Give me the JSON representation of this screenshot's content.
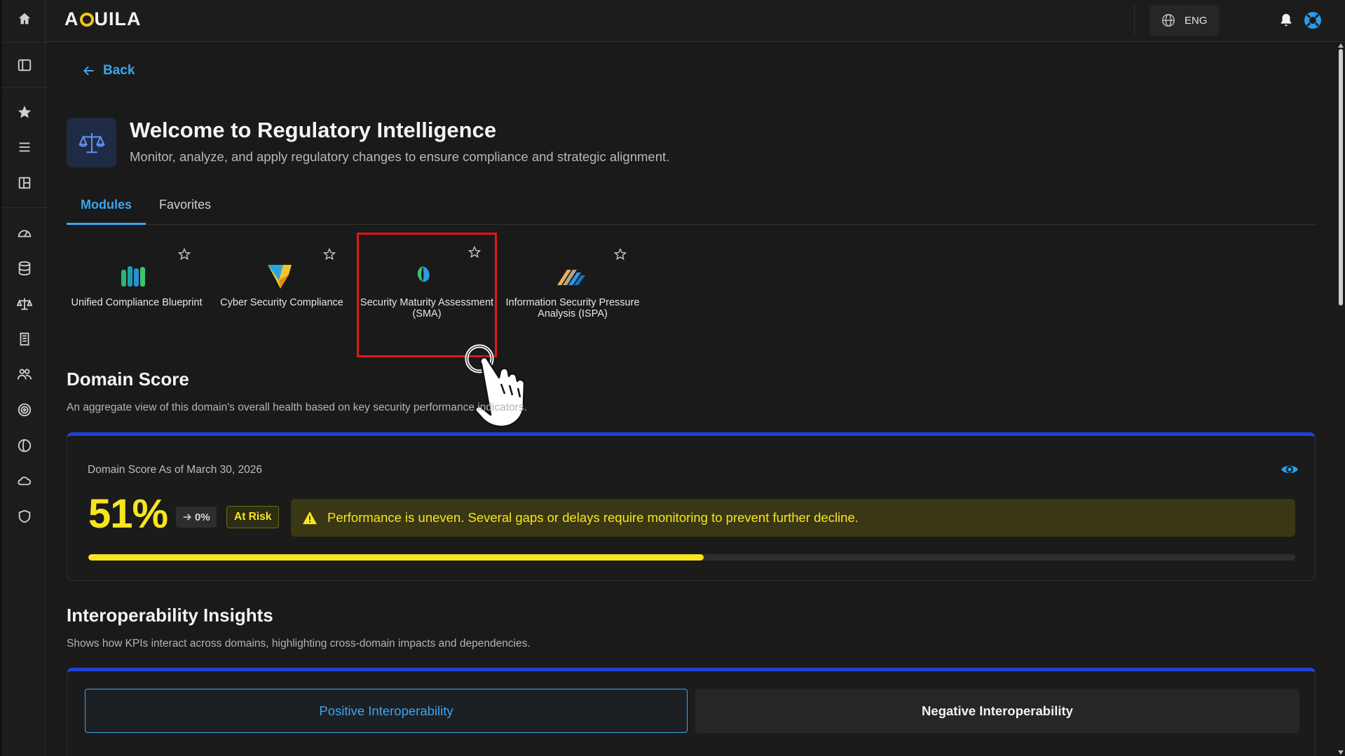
{
  "app": {
    "logo_text_pre": "A",
    "logo_text_post": "UILA"
  },
  "topbar": {
    "language": "ENG"
  },
  "sidebar": {
    "items": [
      "home-icon",
      "panel-icon",
      "star-icon",
      "list-icon",
      "layout-icon",
      "gauge-icon",
      "database-icon",
      "scale-icon",
      "building-icon",
      "users-icon",
      "target-icon",
      "globe-icon",
      "cloud-icon",
      "shield-icon"
    ]
  },
  "nav": {
    "back_label": "Back"
  },
  "hero": {
    "title": "Welcome to Regulatory Intelligence",
    "subtitle": "Monitor, analyze, and apply regulatory changes to ensure compliance and strategic alignment."
  },
  "tabs": {
    "modules": "Modules",
    "favorites": "Favorites"
  },
  "modules": [
    {
      "label": "Unified Compliance Blueprint",
      "icon": "bars-icon"
    },
    {
      "label": "Cyber Security Compliance",
      "icon": "shield-shape-icon"
    },
    {
      "label": "Security Maturity Assessment (SMA)",
      "icon": "leaf-icon"
    },
    {
      "label": "Information Security Pressure Analysis (ISPA)",
      "icon": "stripes-icon"
    }
  ],
  "domain_score": {
    "title": "Domain Score",
    "subtitle": "An aggregate view of this domain's overall health based on key security performance indicators.",
    "date_label": "Domain Score As of March 30, 2026",
    "value": "51%",
    "trend": "0%",
    "status": "At Risk",
    "alert": "Performance is uneven. Several gaps or delays require monitoring to prevent further decline.",
    "progress_percent": 51
  },
  "interoperability": {
    "title": "Interoperability Insights",
    "subtitle": "Shows how KPIs interact across domains, highlighting cross-domain impacts and dependencies.",
    "positive_tab": "Positive Interoperability",
    "negative_tab": "Negative Interoperability"
  },
  "colors": {
    "accent": "#3ba6ee",
    "warning": "#f8e51e",
    "card_stripe": "#2241d6",
    "highlight": "#e5141b"
  }
}
